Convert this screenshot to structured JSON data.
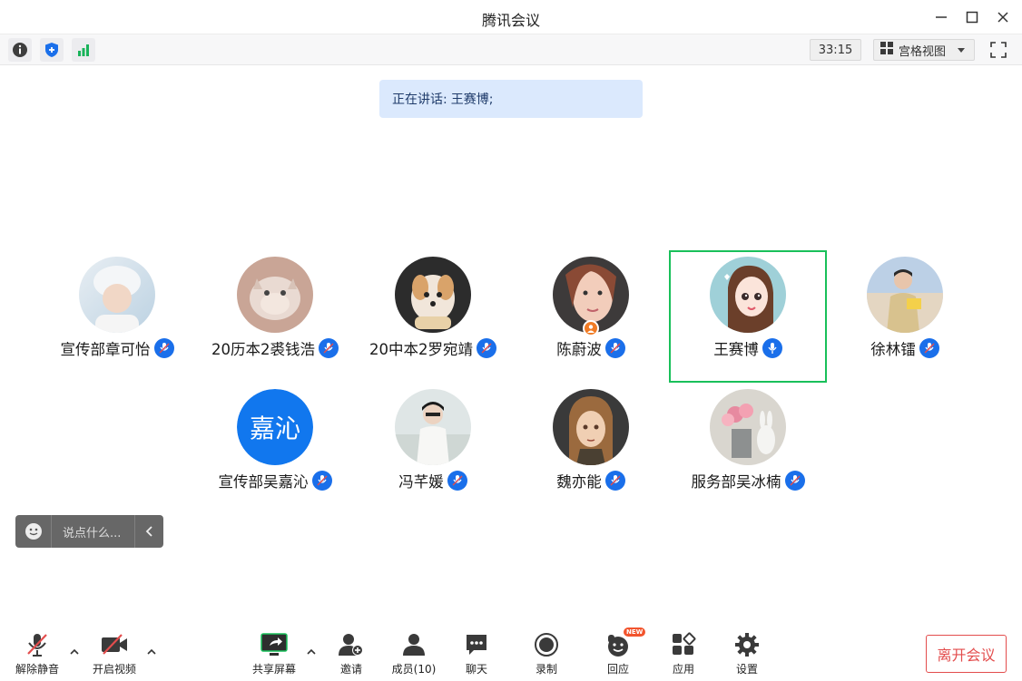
{
  "window": {
    "title": "腾讯会议"
  },
  "infobar": {
    "timer": "33:15",
    "view_label": "宫格视图"
  },
  "speaking": {
    "prefix": "正在讲话:",
    "name": "王赛博;"
  },
  "participants": [
    {
      "name": "宣传部章可怡"
    },
    {
      "name": "20历本2裘钱浩"
    },
    {
      "name": "20中本2罗宛靖"
    },
    {
      "name": "陈蔚波"
    },
    {
      "name": "王赛博"
    },
    {
      "name": "徐林镭"
    },
    {
      "name": "宣传部吴嘉沁",
      "avatar_text": "嘉沁"
    },
    {
      "name": "冯芊媛"
    },
    {
      "name": "魏亦能"
    },
    {
      "name": "服务部吴冰楠"
    }
  ],
  "chat": {
    "placeholder": "说点什么..."
  },
  "toolbar": {
    "unmute": "解除静音",
    "video": "开启视频",
    "share": "共享屏幕",
    "invite": "邀请",
    "members": "成员(10)",
    "chat": "聊天",
    "record": "录制",
    "react": "回应",
    "react_badge": "NEW",
    "apps": "应用",
    "settings": "设置",
    "leave": "离开会议"
  },
  "colors": {
    "accent": "#1a6fea",
    "active_border": "#19c05a",
    "leave": "#e34d4d",
    "speaking_bg": "#dbe9fd"
  }
}
